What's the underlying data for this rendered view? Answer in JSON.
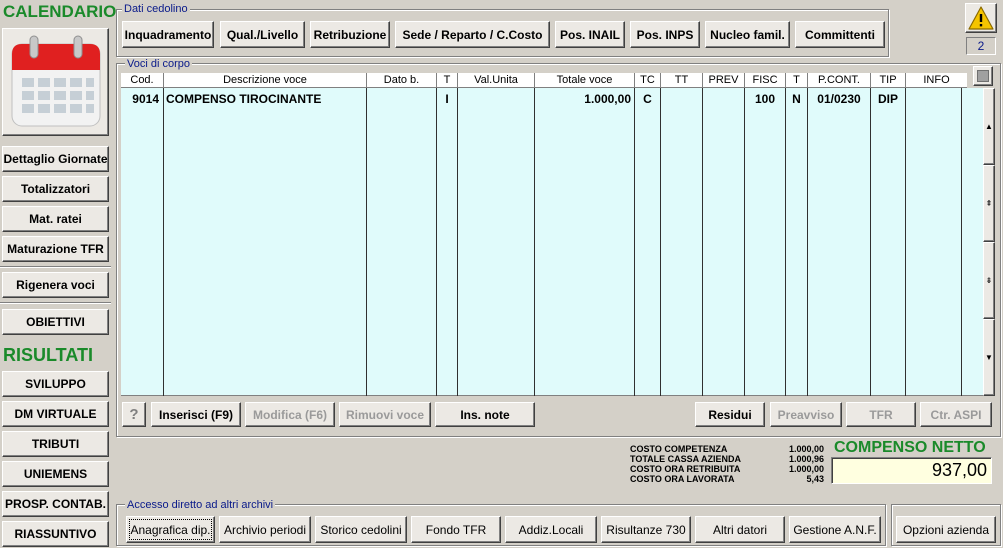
{
  "sidebar": {
    "title": "CALENDARIO",
    "buttons": [
      "Dettaglio Giornate",
      "Totalizzatori",
      "Mat. ratei",
      "Maturazione TFR",
      "Rigenera voci",
      "OBIETTIVI"
    ],
    "results_title": "RISULTATI",
    "results_buttons": [
      "SVILUPPO",
      "DM VIRTUALE",
      "TRIBUTI",
      "UNIEMENS",
      "PROSP. CONTAB.",
      "RIASSUNTIVO"
    ]
  },
  "dati_cedolino": {
    "label": "Dati cedolino",
    "buttons": [
      "Inquadramento",
      "Qual./Livello",
      "Retribuzione",
      "Sede / Reparto / C.Costo",
      "Pos. INAIL",
      "Pos. INPS",
      "Nucleo famil.",
      "Committenti"
    ]
  },
  "warning": {
    "icon": "warning-icon",
    "count": "2",
    "color": "#f5c400"
  },
  "voci": {
    "label": "Voci di corpo",
    "columns": [
      "Cod.",
      "Descrizione voce",
      "Dato b.",
      "T",
      "Val.Unita",
      "Totale voce",
      "TC",
      "TT",
      "PREV",
      "FISC",
      "T",
      "P.CONT.",
      "TIP",
      "INFO"
    ],
    "rows": [
      {
        "cod": "9014",
        "descrizione": "COMPENSO TIROCINANTE",
        "dato_b": "",
        "t": "I",
        "val_unita": "",
        "totale": "1.000,00",
        "tc": "C",
        "tt": "",
        "prev": "",
        "fisc": "100",
        "t2": "N",
        "pcont": "01/0230",
        "tip": "DIP",
        "info": ""
      }
    ],
    "toolbar": {
      "help": "?",
      "inserisci": "Inserisci (F9)",
      "modifica": "Modifica (F6)",
      "rimuovi": "Rimuovi voce",
      "ins_note": "Ins. note",
      "residui": "Residui",
      "preavviso": "Preavviso",
      "tfr": "TFR",
      "ctr_aspi": "Ctr. ASPI"
    }
  },
  "summary": {
    "costo_competenza_label": "COSTO COMPETENZA",
    "costo_competenza": "1.000,00",
    "totale_cassa_label": "TOTALE CASSA AZIENDA",
    "totale_cassa": "1.000,96",
    "costo_ora_retr_label": "COSTO ORA RETRIBUITA",
    "costo_ora_retr": "1.000,00",
    "costo_ora_lav_label": "COSTO ORA LAVORATA",
    "costo_ora_lav": "5,43",
    "compenso_label": "COMPENSO NETTO",
    "compenso_value": "937,00",
    "accent": "#1a8a2a",
    "value_bg": "#ffffe0"
  },
  "accesso": {
    "label": "Accesso diretto ad altri archivi",
    "buttons": [
      "Anagrafica dip.",
      "Archivio periodi",
      "Storico cedolini",
      "Fondo TFR",
      "Addiz.Locali",
      "Risultanze 730",
      "Altri datori",
      "Gestione A.N.F."
    ],
    "opzioni": "Opzioni azienda"
  }
}
